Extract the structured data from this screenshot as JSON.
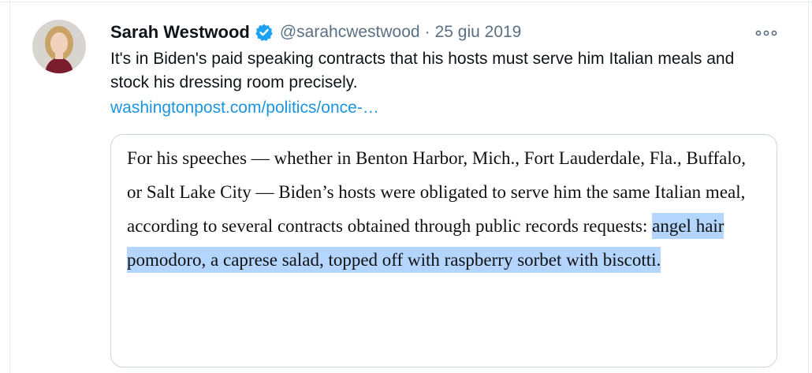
{
  "tweet": {
    "display_name": "Sarah Westwood",
    "handle": "@sarahcwestwood",
    "separator": "·",
    "date": "25 giu 2019",
    "text": "It's in Biden's paid speaking contracts that his hosts must serve him Italian meals and stock his dressing room precisely.",
    "link": "washingtonpost.com/politics/once-…",
    "verified_icon": "verified-badge-icon",
    "more_icon": "more-options-icon"
  },
  "quote_card": {
    "text_plain": "For his speeches — whether in Benton Harbor, Mich., Fort Lauderdale, Fla., Buffalo, or Salt Lake City — Biden’s hosts were obligated to serve him the same Italian meal, according to several contracts obtained through public records requests: ",
    "text_highlighted": "angel hair pomodoro, a caprese salad, topped off with raspberry sorbet with biscotti.",
    "highlight_color": "#b4d5fe"
  },
  "colors": {
    "text": "#0f1419",
    "muted": "#5b7083",
    "link": "#1b95e0",
    "verified": "#1da1f2",
    "border": "#ccd6dd"
  }
}
